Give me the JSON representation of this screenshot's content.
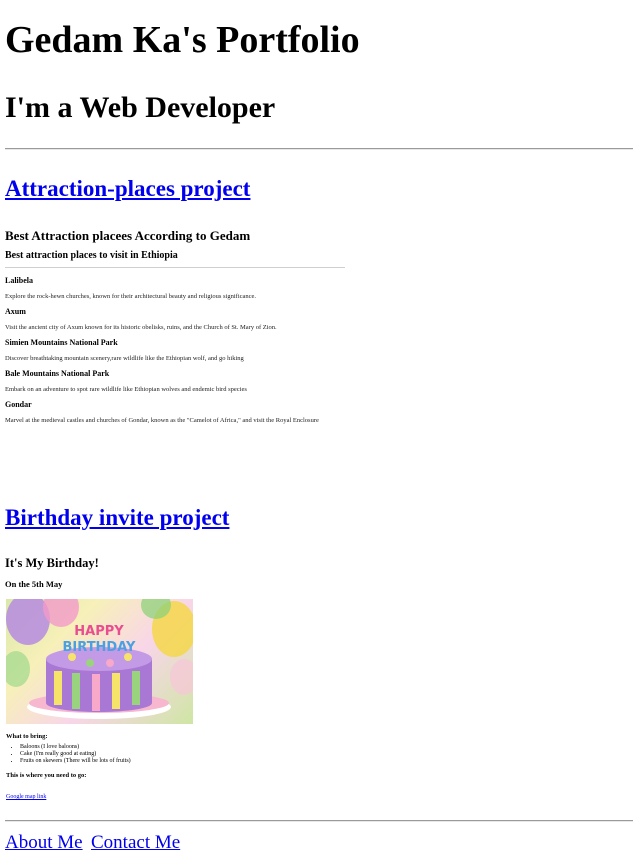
{
  "header": {
    "title": "Gedam Ka's Portfolio",
    "subtitle": "I'm a Web Developer"
  },
  "projects": [
    {
      "link_label": "Attraction-places project",
      "content": {
        "heading": "Best Attraction placees According to Gedam",
        "subheading": "Best attraction places to visit in Ethiopia",
        "places": [
          {
            "name": "Lalibela",
            "desc": "Explore the rock-hewn churches, known for their architectural beauty and religious significance."
          },
          {
            "name": "Axum",
            "desc": "Visit the ancient city of Axum known for its historic obelisks, ruins, and the Church of St. Mary of Zion."
          },
          {
            "name": "Simien Mountains National Park",
            "desc": "Discover breathtaking mountain scenery,rare wildlife like the Ethiopian wolf, and go hiking"
          },
          {
            "name": "Bale Mountains National Park",
            "desc": "Embark on an adventure to spot rare wildlife like Ethiopian wolves and endemic bird species"
          },
          {
            "name": "Gondar",
            "desc": "Marvel at the medieval castles and churches of Gondar, known as the \"Camelot of Africa,\" and visit the Royal Enclosure"
          }
        ]
      }
    },
    {
      "link_label": "Birthday invite project",
      "content": {
        "heading": "It's My Birthday!",
        "date": "On the 5th May",
        "image_text": "HAPPY BIRTHDAY",
        "bring_heading": "What to bring:",
        "bring_items": [
          "Baloons (I love baloons)",
          "Cake (I'm really good at eating)",
          "Fruits on skewers (There will be lots of fruits)"
        ],
        "where_heading": "This is where you need to go:",
        "map_link": "Google map link"
      }
    }
  ],
  "footer": {
    "about": "About Me",
    "contact": "Contact Me"
  },
  "colors": {
    "link": "#0000ee",
    "rule": "#9a9a9a"
  }
}
